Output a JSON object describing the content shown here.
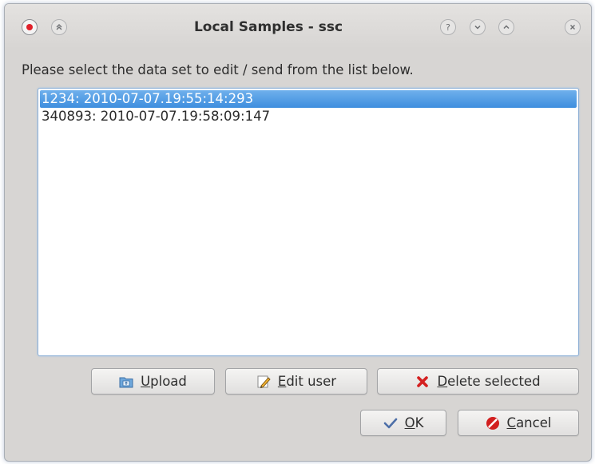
{
  "window": {
    "title": "Local Samples - ssc"
  },
  "dialog": {
    "prompt": "Please select the data set to edit / send from the list below."
  },
  "list": {
    "items": [
      {
        "label": "1234: 2010-07-07.19:55:14:293",
        "selected": true
      },
      {
        "label": "340893: 2010-07-07.19:58:09:147",
        "selected": false
      }
    ]
  },
  "buttons": {
    "upload": {
      "mnemonic": "U",
      "rest": "pload",
      "icon": "upload-icon"
    },
    "edit_user": {
      "mnemonic": "E",
      "rest": "dit user",
      "icon": "pencil-icon"
    },
    "delete_selected": {
      "mnemonic": "D",
      "rest": "elete selected",
      "icon": "red-x-icon"
    },
    "ok": {
      "mnemonic": "O",
      "rest": "K",
      "icon": "checkmark-icon"
    },
    "cancel": {
      "mnemonic": "C",
      "rest": "ancel",
      "icon": "cancel-icon"
    }
  },
  "colors": {
    "selection": "#3e8ede",
    "window_bg": "#d7d5d3",
    "delete_icon": "#d42020",
    "cancel_icon": "#d21e1e"
  }
}
